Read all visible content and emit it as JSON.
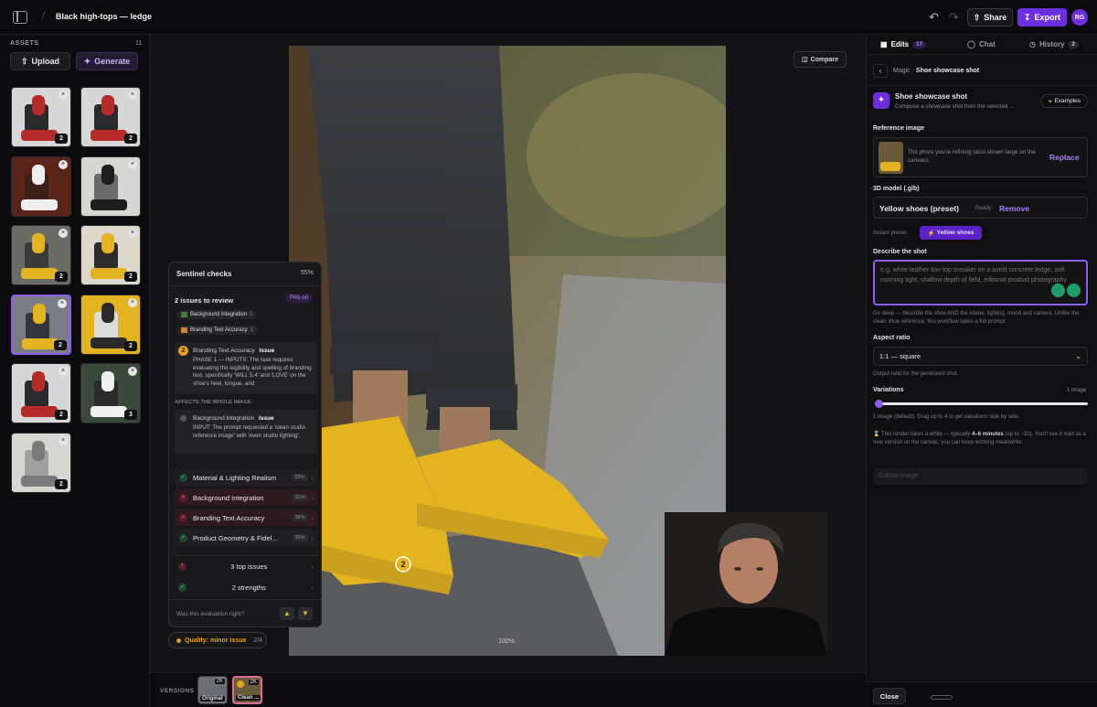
{
  "header": {
    "title": "Black high-tops — ledge",
    "share_label": "Share",
    "export_label": "Export",
    "avatar_initials": "RG"
  },
  "assets": {
    "heading": "ASSETS",
    "count": "11",
    "upload_label": "Upload",
    "generate_label": "Generate",
    "thumbnails": [
      {
        "subject": "sitting-red-shirt",
        "count": "2"
      },
      {
        "subject": "sitting-red-shirt",
        "count": "2"
      },
      {
        "subject": "white-sneaker-closeup",
        "count": ""
      },
      {
        "subject": "black-shoe-closeup",
        "count": ""
      },
      {
        "subject": "yellow-shoes-ledge",
        "count": "2"
      },
      {
        "subject": "yellow-shoes-closeup",
        "count": "2"
      },
      {
        "subject": "yellow-shoes-jeans",
        "count": "2"
      },
      {
        "subject": "seated-yellow-background",
        "count": "2"
      },
      {
        "subject": "sitting-red-shirt",
        "count": "2"
      },
      {
        "subject": "standing-man-street",
        "count": "3"
      },
      {
        "subject": "grey-outfit-lounging",
        "count": "2"
      }
    ]
  },
  "canvas": {
    "compare_label": "Compare",
    "zoom_level": "100%",
    "marker_number": "2"
  },
  "sentinel": {
    "title": "Sentinel checks",
    "percent": "55%",
    "issues_heading": "2 issues to review",
    "pins_label": "Pins on",
    "issue_tags": [
      {
        "label": "Background Integration",
        "count": "1"
      },
      {
        "label": "Branding Text Accuracy",
        "count": "1"
      }
    ],
    "issue_detail": {
      "number": "2",
      "category": "Branding Text Accuracy",
      "status": "Issue",
      "text": "PHASE 1 — INPUTS: The task requires evaluating the legibility and spelling of branding text, specifically 'WILL 5,4' and 'LOVE' on the shoe's heel, tongue, and"
    },
    "whole_image_heading": "AFFECTS THE WHOLE IMAGE",
    "whole_issue": {
      "category": "Background Integration",
      "status": "Issue",
      "text": "INPUT: The prompt requested a 'clean studio reference image' with 'even studio lighting'."
    },
    "checks": [
      {
        "label": "Material & Lighting Realism",
        "score": "93%",
        "pass": true
      },
      {
        "label": "Background Integration",
        "score": "35%",
        "pass": false
      },
      {
        "label": "Branding Text Accuracy",
        "score": "98%",
        "pass": false
      },
      {
        "label": "Product Geometry & Fidel...",
        "score": "95%",
        "pass": true
      }
    ],
    "top_issues_label": "3 top issues",
    "strengths_label": "2 strengths",
    "feedback_question": "Was this evaluation right?"
  },
  "quality": {
    "label": "Quality: minor issue",
    "ratio": "2/4"
  },
  "versions": {
    "label": "VERSIONS",
    "items": [
      {
        "res": "2K",
        "name": "Original"
      },
      {
        "res": "2K",
        "name": "Clean ..."
      }
    ]
  },
  "right_panel": {
    "tabs": [
      {
        "label": "Edits",
        "count": "17"
      },
      {
        "label": "Chat",
        "count": ""
      },
      {
        "label": "History",
        "count": "2"
      }
    ],
    "breadcrumb": {
      "parent": "Magic",
      "current": "Shoe showcase shot"
    },
    "preset": {
      "title": "Shoe showcase shot",
      "desc": "Compose a showcase shot from the selected ...",
      "examples_label": "Examples"
    },
    "reference_image": {
      "label": "Reference image",
      "text": "The photo you're refining (also shown large on the canvas).",
      "replace_label": "Replace"
    },
    "model": {
      "label": "3D model (.glb)",
      "name": "Yellow shoes (preset)",
      "status": "Ready",
      "remove_label": "Remove"
    },
    "instant_preset": {
      "label": "Instant preset:",
      "chip": "Yellow shoes"
    },
    "describe": {
      "label": "Describe the shot",
      "placeholder": "e.g. white leather low-top sneaker on a sunlit concrete ledge, soft morning light, shallow depth of field, editorial product photography",
      "hint": "Go deep — describe the shoe AND the scene, lighting, mood and camera. Unlike the clean shoe reference, this workflow takes a full prompt."
    },
    "aspect": {
      "label": "Aspect ratio",
      "value": "1:1 — square",
      "hint": "Output ratio for the generated shot."
    },
    "variations": {
      "label": "Variations",
      "count_label": "1 image",
      "value": 0.0,
      "hint": "1 image (default). Drag up to 4 to get variations side by side."
    },
    "render_note_pre": "This render takes a while — typically ",
    "render_note_bold": "4–6 minutes",
    "render_note_post": " (up to ~10). You'll see it load as a new version on the canvas; you can keep working meanwhile.",
    "submit_label": "Submit image",
    "close_label": "Close"
  },
  "colors": {
    "accent": "#6d2ee0",
    "accent_light": "#8b5cf6",
    "pass": "#2f9e5a",
    "fail": "#c0394b",
    "warning": "#e0a020",
    "shoe_yellow": "#e3b320"
  }
}
